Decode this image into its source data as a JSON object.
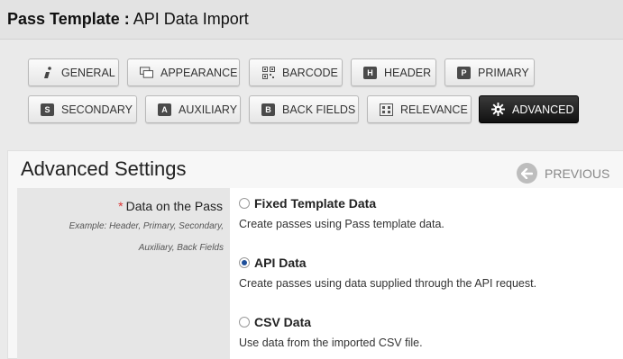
{
  "header": {
    "title_prefix": "Pass Template :",
    "title_suffix": "API Data Import"
  },
  "tabs": [
    {
      "label": "GENERAL",
      "icon": "info-icon"
    },
    {
      "label": "APPEARANCE",
      "icon": "appearance-icon"
    },
    {
      "label": "BARCODE",
      "icon": "qr-code-icon"
    },
    {
      "label": "HEADER",
      "icon": "letter-h-icon",
      "letter": "H"
    },
    {
      "label": "PRIMARY",
      "icon": "letter-p-icon",
      "letter": "P"
    },
    {
      "label": "SECONDARY",
      "icon": "letter-s-icon",
      "letter": "S"
    },
    {
      "label": "AUXILIARY",
      "icon": "letter-a-icon",
      "letter": "A"
    },
    {
      "label": "BACK FIELDS",
      "icon": "letter-b-icon",
      "letter": "B"
    },
    {
      "label": "RELEVANCE",
      "icon": "relevance-icon"
    },
    {
      "label": "ADVANCED",
      "icon": "gear-icon",
      "active": true
    }
  ],
  "section": {
    "title": "Advanced Settings",
    "previous_label": "PREVIOUS"
  },
  "field": {
    "required_mark": "*",
    "label": "Data on the Pass",
    "example_line1": "Example: Header, Primary, Secondary,",
    "example_line2": "Auxiliary, Back Fields"
  },
  "options": [
    {
      "title": "Fixed Template Data",
      "description": "Create passes using Pass template data.",
      "checked": false
    },
    {
      "title": "API Data",
      "description": "Create passes using data supplied through the API request.",
      "checked": true
    },
    {
      "title": "CSV Data",
      "description": "Use data from the imported CSV file.",
      "checked": false
    }
  ],
  "colors": {
    "active_tab": "#111111",
    "radio_selected": "#1e4f9a",
    "required": "#dd3333"
  }
}
